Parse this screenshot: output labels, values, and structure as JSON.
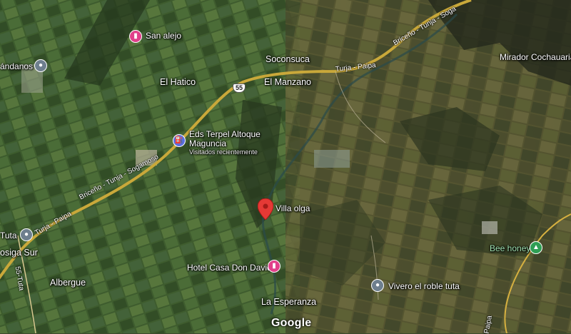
{
  "map": {
    "places": {
      "san_alejo": "San alejo",
      "arandanos": "ándanos",
      "soconsuca": "Soconsuca",
      "el_hatico": "El Hatico",
      "el_manzano": "El Manzano",
      "eds_line1": "Eds Terpel Altoque",
      "eds_line2": "Maguncia",
      "eds_sub": "Visitados recientemente",
      "villa_olga": "Villa olga",
      "tuta": "Tuta",
      "sosiga_sur": "osiga Sur",
      "albergue": "Albergue",
      "hotel_don_david": "Hotel Casa Don David",
      "la_esperanza": "La Esperanza",
      "vivero": "Vivero el roble tuta",
      "bee_honey": "Bee honey",
      "mirador": "Mirador Cochauaria"
    },
    "roads": {
      "north": "Briceño - Tunja - Soga",
      "turja_paipa_top": "Turja - Paipa",
      "briceno_mid": "Briceño - Tunja - Sogamoso",
      "turja_paipa_left": "Turja - Paipa",
      "s5_tuta": "55-Tuta",
      "paipa_bottom": "Paipa",
      "route_shield": "55"
    },
    "attribution": "Google",
    "icons": {
      "hotel": "hotel-icon",
      "gas": "gas-station-icon",
      "poi": "place-icon",
      "park": "park-icon",
      "selected": "red-location-pin-icon"
    }
  }
}
